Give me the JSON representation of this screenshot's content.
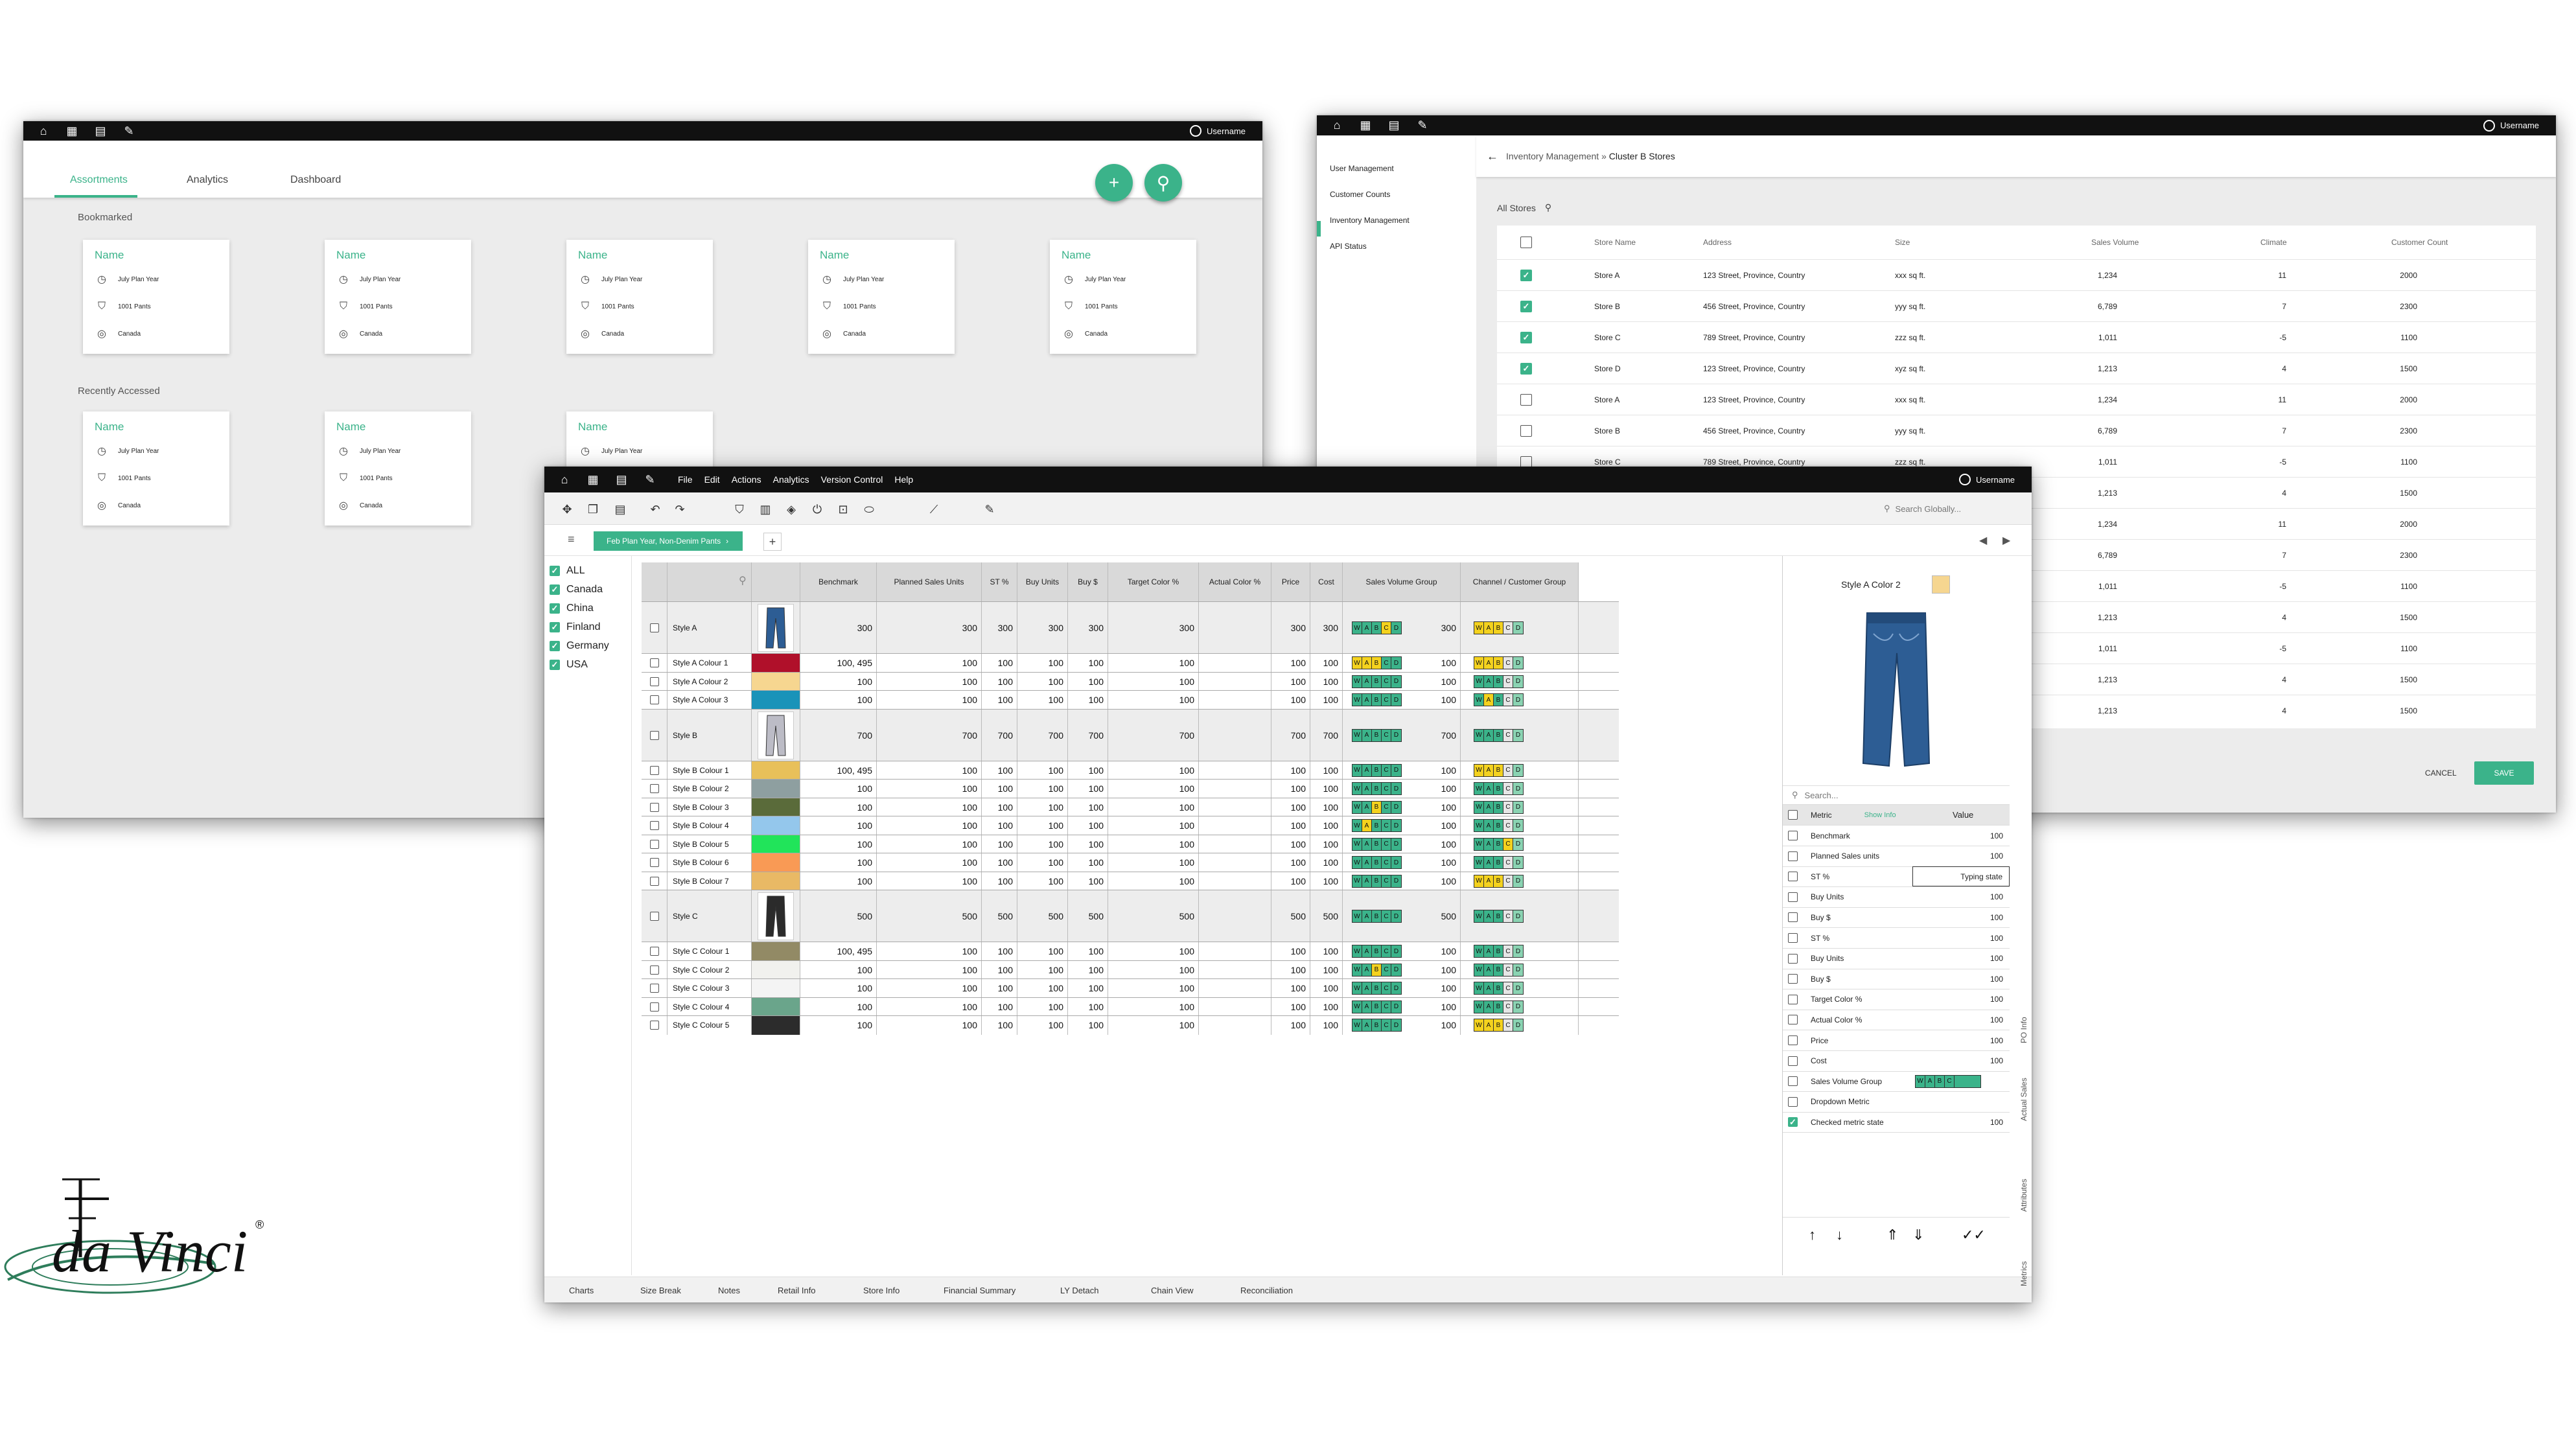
{
  "colors": {
    "accent": "#3bb38a",
    "titlebar": "#111111",
    "bg": "#ececec"
  },
  "user": "Username",
  "assort": {
    "tabs": [
      "Assortments",
      "Analytics",
      "Dashboard"
    ],
    "fab_add": "+",
    "sections": [
      "Bookmarked",
      "Recently Accessed"
    ],
    "cards": [
      {
        "name": "Name",
        "plan": "July Plan Year",
        "items": "1001 Pants",
        "region": "Canada",
        "partial": false
      },
      {
        "name": "Name",
        "plan": "July Plan Year",
        "items": "1001 Pants",
        "region": "Canada",
        "partial": false
      },
      {
        "name": "Name",
        "plan": "July Plan Year",
        "items": "1001 Pants",
        "region": "Canada",
        "partial": false
      },
      {
        "name": "Name",
        "plan": "July Plan Year",
        "items": "1001 Pants",
        "region": "Canada",
        "partial": false
      },
      {
        "name": "Name",
        "plan": "July Plan Year",
        "items": "1001 Pants",
        "region": "Canada",
        "partial": false
      },
      {
        "name": "Name",
        "plan": "July Plan Year",
        "items": "1001 Pants",
        "region": "Canada",
        "partial": false
      },
      {
        "name": "Name",
        "plan": "July Plan Year",
        "items": "1001 Pants",
        "region": "Canada",
        "partial": false
      },
      {
        "name": "Name",
        "plan": "July Plan Year",
        "items": "",
        "region": "",
        "partial": true
      }
    ]
  },
  "inv": {
    "nav": [
      "User Management",
      "Customer Counts",
      "Inventory Management",
      "API Status"
    ],
    "selected_nav": 2,
    "breadcrumb_parent": "Inventory Management",
    "breadcrumb_sep": " » ",
    "breadcrumb_current": "Cluster B Stores",
    "all_stores": "All Stores",
    "columns": [
      "Store Name",
      "Address",
      "Size",
      "Sales Volume",
      "Climate",
      "Customer Count"
    ],
    "rows": [
      {
        "checked": true,
        "name": "Store A",
        "address": "123 Street, Province, Country",
        "size": "xxx sq ft.",
        "sales": "1,234",
        "climate": "11",
        "count": "2000"
      },
      {
        "checked": true,
        "name": "Store B",
        "address": "456 Street, Province, Country",
        "size": "yyy sq ft.",
        "sales": "6,789",
        "climate": "7",
        "count": "2300"
      },
      {
        "checked": true,
        "name": "Store C",
        "address": "789 Street, Province, Country",
        "size": "zzz sq ft.",
        "sales": "1,011",
        "climate": "-5",
        "count": "1100"
      },
      {
        "checked": true,
        "name": "Store D",
        "address": "123 Street, Province, Country",
        "size": "xyz sq ft.",
        "sales": "1,213",
        "climate": "4",
        "count": "1500"
      },
      {
        "checked": false,
        "name": "Store A",
        "address": "123 Street, Province, Country",
        "size": "xxx sq ft.",
        "sales": "1,234",
        "climate": "11",
        "count": "2000"
      },
      {
        "checked": false,
        "name": "Store B",
        "address": "456 Street, Province, Country",
        "size": "yyy sq ft.",
        "sales": "6,789",
        "climate": "7",
        "count": "2300"
      },
      {
        "checked": false,
        "name": "Store C",
        "address": "789 Street, Province, Country",
        "size": "zzz sq ft.",
        "sales": "1,011",
        "climate": "-5",
        "count": "1100"
      },
      {
        "checked": false,
        "name": "",
        "address": "",
        "size": "",
        "sales": "1,213",
        "climate": "4",
        "count": "1500"
      },
      {
        "checked": false,
        "name": "",
        "address": "",
        "size": "",
        "sales": "1,234",
        "climate": "11",
        "count": "2000"
      },
      {
        "checked": false,
        "name": "",
        "address": "",
        "size": "",
        "sales": "6,789",
        "climate": "7",
        "count": "2300"
      },
      {
        "checked": false,
        "name": "",
        "address": "",
        "size": "",
        "sales": "1,011",
        "climate": "-5",
        "count": "1100"
      },
      {
        "checked": false,
        "name": "",
        "address": "",
        "size": "",
        "sales": "1,213",
        "climate": "4",
        "count": "1500"
      },
      {
        "checked": false,
        "name": "",
        "address": "",
        "size": "",
        "sales": "1,011",
        "climate": "-5",
        "count": "1100"
      },
      {
        "checked": false,
        "name": "",
        "address": "",
        "size": "",
        "sales": "1,213",
        "climate": "4",
        "count": "1500"
      },
      {
        "checked": false,
        "name": "",
        "address": "",
        "size": "",
        "sales": "1,213",
        "climate": "4",
        "count": "1500"
      }
    ],
    "cancel": "CANCEL",
    "save": "SAVE"
  },
  "main": {
    "menus": [
      "File",
      "Edit",
      "Actions",
      "Analytics",
      "Version Control",
      "Help"
    ],
    "search_placeholder": "Search Globally...",
    "plan_tab": "Feb Plan Year, Non-Denim Pants",
    "add_tab": "+",
    "countries": [
      {
        "label": "ALL",
        "checked": true
      },
      {
        "label": "Canada",
        "checked": true
      },
      {
        "label": "China",
        "checked": true
      },
      {
        "label": "Finland",
        "checked": true
      },
      {
        "label": "Germany",
        "checked": true
      },
      {
        "label": "USA",
        "checked": true
      }
    ],
    "columns": [
      "",
      "",
      "",
      "Benchmark",
      "Planned Sales Units",
      "ST %",
      "Buy Units",
      "Buy $",
      "Target Color %",
      "Actual Color %",
      "Price",
      "Cost",
      "Sales Volume Group",
      "Channel / Customer Group"
    ],
    "rows": [
      {
        "kind": "style",
        "name": "Style A",
        "img": "jeans",
        "vals": [
          "300",
          "300",
          "300",
          "300",
          "300",
          "300",
          "",
          "300",
          "300",
          "300"
        ],
        "svg": "WABCD",
        "svg_on": [
          3
        ],
        "cg": "WABCD",
        "cg_on": [
          0,
          1,
          2
        ]
      },
      {
        "kind": "color",
        "name": "Style A Colour 1",
        "swatch": "#b0102a",
        "vals": [
          "100, 495",
          "100",
          "100",
          "100",
          "100",
          "100",
          "",
          "100",
          "100",
          "100"
        ],
        "svg_on": [
          0,
          1,
          2
        ],
        "cg_on": [
          0,
          1,
          2
        ]
      },
      {
        "kind": "color",
        "name": "Style A Colour 2",
        "swatch": "#f6d690",
        "vals": [
          "100",
          "100",
          "100",
          "100",
          "100",
          "100",
          "",
          "100",
          "100",
          "100"
        ],
        "svg_on": [],
        "cg_on": []
      },
      {
        "kind": "color",
        "name": "Style A Colour 3",
        "swatch": "#1a93b9",
        "vals": [
          "100",
          "100",
          "100",
          "100",
          "100",
          "100",
          "",
          "100",
          "100",
          "100"
        ],
        "svg_on": [],
        "cg_on": [
          1
        ]
      },
      {
        "kind": "style",
        "name": "Style B",
        "img": "track",
        "vals": [
          "700",
          "700",
          "700",
          "700",
          "700",
          "700",
          "",
          "700",
          "700",
          "700"
        ],
        "svg_on": [],
        "cg_on": []
      },
      {
        "kind": "color",
        "name": "Style B Colour 1",
        "swatch": "#e8c05a",
        "vals": [
          "100, 495",
          "100",
          "100",
          "100",
          "100",
          "100",
          "",
          "100",
          "100",
          "100"
        ],
        "svg_on": [],
        "cg_on": [
          0,
          1,
          2
        ]
      },
      {
        "kind": "color",
        "name": "Style B Colour 2",
        "swatch": "#8e9fa0",
        "vals": [
          "100",
          "100",
          "100",
          "100",
          "100",
          "100",
          "",
          "100",
          "100",
          "100"
        ],
        "svg_on": [],
        "cg_on": []
      },
      {
        "kind": "color",
        "name": "Style B Colour 3",
        "swatch": "#5a6b3a",
        "vals": [
          "100",
          "100",
          "100",
          "100",
          "100",
          "100",
          "",
          "100",
          "100",
          "100"
        ],
        "svg_on": [
          2
        ],
        "cg_on": []
      },
      {
        "kind": "color",
        "name": "Style B Colour 4",
        "swatch": "#94c7ec",
        "vals": [
          "100",
          "100",
          "100",
          "100",
          "100",
          "100",
          "",
          "100",
          "100",
          "100"
        ],
        "svg_on": [
          1
        ],
        "cg_on": []
      },
      {
        "kind": "color",
        "name": "Style B Colour 5",
        "swatch": "#21e45a",
        "vals": [
          "100",
          "100",
          "100",
          "100",
          "100",
          "100",
          "",
          "100",
          "100",
          "100"
        ],
        "svg_on": [],
        "cg_on": [
          3
        ]
      },
      {
        "kind": "color",
        "name": "Style B Colour 6",
        "swatch": "#f99a55",
        "vals": [
          "100",
          "100",
          "100",
          "100",
          "100",
          "100",
          "",
          "100",
          "100",
          "100"
        ],
        "svg_on": [],
        "cg_on": []
      },
      {
        "kind": "color",
        "name": "Style B Colour 7",
        "swatch": "#e9b965",
        "vals": [
          "100",
          "100",
          "100",
          "100",
          "100",
          "100",
          "",
          "100",
          "100",
          "100"
        ],
        "svg_on": [],
        "cg_on": [
          0,
          1,
          2
        ]
      },
      {
        "kind": "style",
        "name": "Style C",
        "img": "pants",
        "vals": [
          "500",
          "500",
          "500",
          "500",
          "500",
          "500",
          "",
          "500",
          "500",
          "500"
        ],
        "svg_on": [],
        "cg_on": []
      },
      {
        "kind": "color",
        "name": "Style C Colour 1",
        "swatch": "#928a65",
        "vals": [
          "100, 495",
          "100",
          "100",
          "100",
          "100",
          "100",
          "",
          "100",
          "100",
          "100"
        ],
        "svg_on": [],
        "cg_on": []
      },
      {
        "kind": "color",
        "name": "Style C Colour 2",
        "swatch": "#f1f1ee",
        "vals": [
          "100",
          "100",
          "100",
          "100",
          "100",
          "100",
          "",
          "100",
          "100",
          "100"
        ],
        "svg_on": [
          2
        ],
        "cg_on": []
      },
      {
        "kind": "color",
        "name": "Style C Colour 3",
        "swatch": "#f4f4f4",
        "vals": [
          "100",
          "100",
          "100",
          "100",
          "100",
          "100",
          "",
          "100",
          "100",
          "100"
        ],
        "svg_on": [],
        "cg_on": []
      },
      {
        "kind": "color",
        "name": "Style C Colour 4",
        "swatch": "#6aa58b",
        "vals": [
          "100",
          "100",
          "100",
          "100",
          "100",
          "100",
          "",
          "100",
          "100",
          "100"
        ],
        "svg_on": [],
        "cg_on": []
      },
      {
        "kind": "color",
        "name": "Style C Colour 5",
        "swatch": "#2c2c2c",
        "vals": [
          "100",
          "100",
          "100",
          "100",
          "100",
          "100",
          "",
          "100",
          "100",
          "100"
        ],
        "svg_on": [],
        "cg_on": [
          0,
          1,
          2
        ]
      }
    ],
    "detail": {
      "title": "Style A Color 2",
      "swatch": "#f6d690",
      "search_placeholder": "Search...",
      "metric_header": "Metric",
      "show_info": "Show Info",
      "value_header": "Value",
      "metrics": [
        {
          "name": "Benchmark",
          "value": "100",
          "checked": false
        },
        {
          "name": "Planned Sales units",
          "value": "100",
          "checked": false
        },
        {
          "name": "ST %",
          "value": "Typing state",
          "checked": false,
          "typing": true
        },
        {
          "name": "Buy Units",
          "value": "100",
          "checked": false
        },
        {
          "name": "Buy $",
          "value": "100",
          "checked": false
        },
        {
          "name": "ST %",
          "value": "100",
          "checked": false
        },
        {
          "name": "Buy Units",
          "value": "100",
          "checked": false
        },
        {
          "name": "Buy $",
          "value": "100",
          "checked": false
        },
        {
          "name": "Target Color %",
          "value": "100",
          "checked": false
        },
        {
          "name": "Actual Color %",
          "value": "100",
          "checked": false
        },
        {
          "name": "Price",
          "value": "100",
          "checked": false
        },
        {
          "name": "Cost",
          "value": "100",
          "checked": false
        },
        {
          "name": "Sales Volume Group",
          "value": "",
          "checked": false,
          "chip": true
        },
        {
          "name": "Dropdown Metric",
          "value": "",
          "checked": false
        },
        {
          "name": "Checked metric state",
          "value": "100",
          "checked": true
        }
      ],
      "side_tabs": [
        "PO Info",
        "Actual Sales",
        "Attributes",
        "Metrics"
      ]
    },
    "bottom_tabs": [
      "Charts",
      "Size Break",
      "Notes",
      "Retail Info",
      "Store Info",
      "Financial Summary",
      "LY Detach",
      "Chain View",
      "Reconciliation"
    ]
  },
  "logo": {
    "text": "da Vinci",
    "reg": "®"
  }
}
